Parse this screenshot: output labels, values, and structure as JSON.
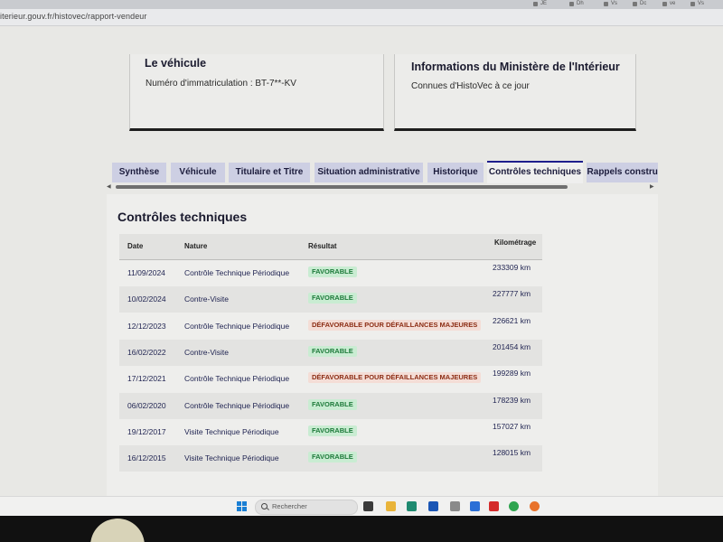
{
  "browser": {
    "url": "iterieur.gouv.fr/histovec/rapport-vendeur",
    "tab_labels": [
      "JE",
      "Dh",
      "Vs",
      "Dc",
      "ve",
      "Vs"
    ]
  },
  "cards": {
    "vehicule": {
      "title": "Le véhicule",
      "text": "Numéro d'immatriculation : BT-7**-KV"
    },
    "ministere": {
      "title": "Informations du Ministère de l'Intérieur",
      "text": "Connues d'HistoVec à ce jour"
    }
  },
  "tabs": [
    {
      "label": "Synthèse"
    },
    {
      "label": "Véhicule"
    },
    {
      "label": "Titulaire et Titre"
    },
    {
      "label": "Situation administrative"
    },
    {
      "label": "Historique"
    },
    {
      "label": "Contrôles techniques",
      "active": true
    },
    {
      "label": "Rappels construc"
    }
  ],
  "section": {
    "title": "Contrôles techniques"
  },
  "table": {
    "headers": {
      "date": "Date",
      "nature": "Nature",
      "resultat": "Résultat",
      "km": "Kilométrage"
    },
    "rows": [
      {
        "date": "11/09/2024",
        "nature": "Contrôle Technique Périodique",
        "result": "FAVORABLE",
        "km": "233309 km"
      },
      {
        "date": "10/02/2024",
        "nature": "Contre-Visite",
        "result": "FAVORABLE",
        "km": "227777 km"
      },
      {
        "date": "12/12/2023",
        "nature": "Contrôle Technique Périodique",
        "result": "DÉFAVORABLE POUR DÉFAILLANCES MAJEURES",
        "km": "226621 km"
      },
      {
        "date": "16/02/2022",
        "nature": "Contre-Visite",
        "result": "FAVORABLE",
        "km": "201454 km"
      },
      {
        "date": "17/12/2021",
        "nature": "Contrôle Technique Périodique",
        "result": "DÉFAVORABLE POUR DÉFAILLANCES MAJEURES",
        "km": "199289 km"
      },
      {
        "date": "06/02/2020",
        "nature": "Contrôle Technique Périodique",
        "result": "FAVORABLE",
        "km": "178239 km"
      },
      {
        "date": "19/12/2017",
        "nature": "Visite Technique Périodique",
        "result": "FAVORABLE",
        "km": "157027 km"
      },
      {
        "date": "16/12/2015",
        "nature": "Visite Technique Périodique",
        "result": "FAVORABLE",
        "km": "128015 km"
      }
    ]
  },
  "taskbar": {
    "search_placeholder": "Rechercher"
  },
  "colors": {
    "accent_tab_border": "#1e1e8c",
    "favorable_bg": "#c9ecd2",
    "favorable_text": "#1d7a3a",
    "defavorable_bg": "#f4ddd6",
    "defavorable_text": "#8c2d14"
  }
}
